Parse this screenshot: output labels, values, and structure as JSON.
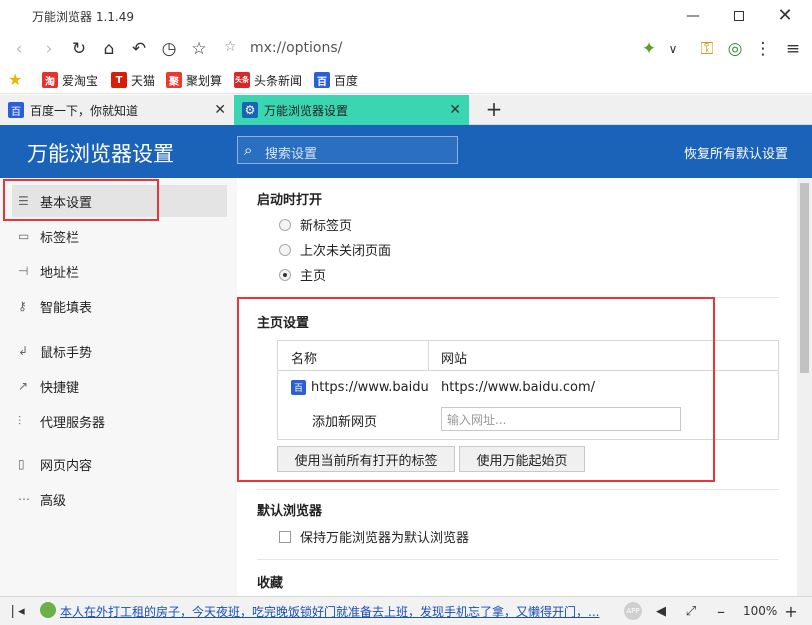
{
  "window": {
    "title": "万能浏览器 1.1.49"
  },
  "address_bar": {
    "url": "mx://options/"
  },
  "bookmarks": [
    {
      "label": "爱淘宝",
      "color": "#e5322d",
      "glyph": "淘"
    },
    {
      "label": "天猫",
      "color": "#d81e06",
      "glyph": "T"
    },
    {
      "label": "聚划算",
      "color": "#e83a30",
      "glyph": "聚"
    },
    {
      "label": "头条新闻",
      "color": "#d7282a",
      "glyph": "头条"
    },
    {
      "label": "百度",
      "color": "#2b5fd8",
      "glyph": "百"
    }
  ],
  "tabs": [
    {
      "label": "百度一下，你就知道",
      "active": false
    },
    {
      "label": "万能浏览器设置",
      "active": true
    }
  ],
  "colors": {
    "header_blue": "#1a63b8",
    "active_tab": "#3ad6b1",
    "highlight_red": "#e8343a"
  },
  "header": {
    "title": "万能浏览器设置",
    "search_placeholder": "搜索设置",
    "restore_defaults": "恢复所有默认设置"
  },
  "sidebar": {
    "items": [
      {
        "label": "基本设置",
        "icon": "sliders-icon"
      },
      {
        "label": "标签栏",
        "icon": "tabbar-icon"
      },
      {
        "label": "地址栏",
        "icon": "addressbar-icon"
      },
      {
        "label": "智能填表",
        "icon": "key-icon"
      },
      {
        "label": "鼠标手势",
        "icon": "gesture-icon"
      },
      {
        "label": "快捷键",
        "icon": "shortcut-icon"
      },
      {
        "label": "代理服务器",
        "icon": "proxy-icon"
      },
      {
        "label": "网页内容",
        "icon": "page-icon"
      },
      {
        "label": "高级",
        "icon": "more-icon"
      }
    ]
  },
  "startup": {
    "title": "启动时打开",
    "options": [
      "新标签页",
      "上次未关闭页面",
      "主页"
    ],
    "selected": "主页"
  },
  "homepage": {
    "title": "主页设置",
    "col_name": "名称",
    "col_site": "网站",
    "row_name": "https://www.baidu.c",
    "row_site": "https://www.baidu.com/",
    "add_label": "添加新网页",
    "add_placeholder": "输入网址...",
    "btn_use_open_tabs": "使用当前所有打开的标签",
    "btn_use_start_page": "使用万能起始页"
  },
  "default_browser": {
    "title": "默认浏览器",
    "checkbox_label": "保持万能浏览器为默认浏览器"
  },
  "favorites": {
    "title": "收藏"
  },
  "statusbar": {
    "news": "本人在外打工租的房子，今天夜班，吃完晚饭锁好门就准备去上班，发现手机忘了拿，又懒得开门，...",
    "zoom": "100%"
  }
}
